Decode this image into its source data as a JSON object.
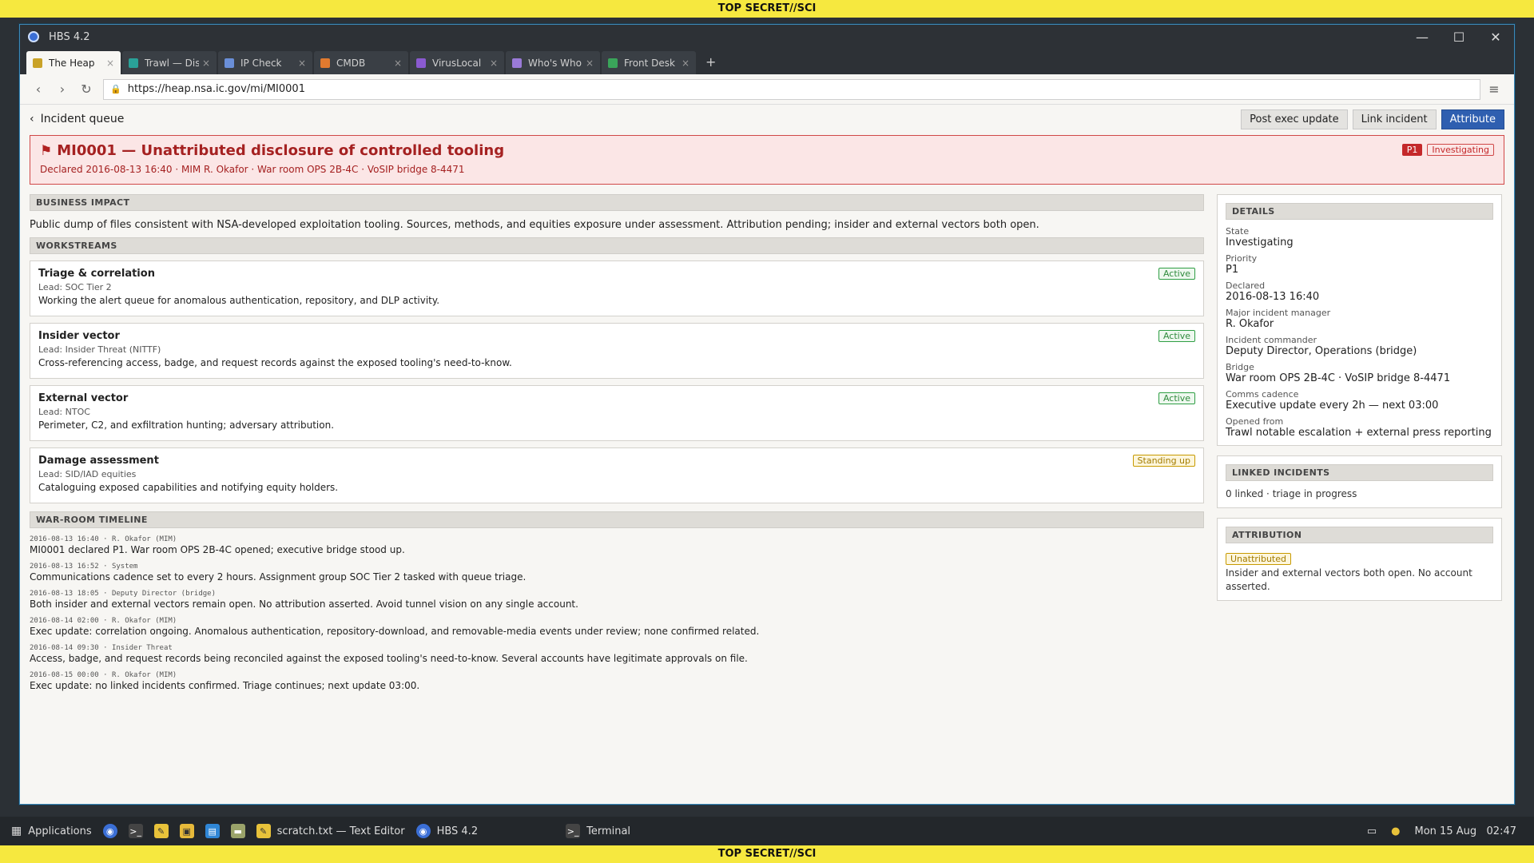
{
  "classification": "TOP SECRET//SCI",
  "window": {
    "title": "HBS 4.2",
    "minimize": "—",
    "maximize": "☐",
    "close": "✕"
  },
  "tabs": [
    {
      "label": "The Heap",
      "icon": "stack-icon",
      "color": "#c9a227"
    },
    {
      "label": "Trawl — Discover",
      "icon": "trawl-icon",
      "color": "#2aa198"
    },
    {
      "label": "IP Check",
      "icon": "globe-icon",
      "color": "#6a8fd8"
    },
    {
      "label": "CMDB",
      "icon": "database-icon",
      "color": "#e07a2f"
    },
    {
      "label": "VirusLocal",
      "icon": "shield-icon",
      "color": "#8a5ad0"
    },
    {
      "label": "Who's Who",
      "icon": "person-icon",
      "color": "#9a7ad8"
    },
    {
      "label": "Front Desk",
      "icon": "bell-icon",
      "color": "#3aa55a"
    }
  ],
  "tab_close": "×",
  "new_tab": "+",
  "nav": {
    "back": "‹",
    "forward": "›",
    "reload": "↻",
    "url": "https://heap.nsa.ic.gov/mi/MI0001",
    "menu": "≡"
  },
  "header": {
    "back_label": "Incident queue",
    "buttons": {
      "post": "Post exec update",
      "link": "Link incident",
      "attribute": "Attribute"
    }
  },
  "incident": {
    "title": "MI0001 — Unattributed disclosure of controlled tooling",
    "meta": "Declared 2016-08-13 16:40  ·  MIM R. Okafor  ·  War room OPS 2B-4C · VoSIP bridge 8-4471",
    "priority": "P1",
    "state": "Investigating"
  },
  "impact": {
    "heading": "BUSINESS IMPACT",
    "text": "Public dump of files consistent with NSA-developed exploitation tooling. Sources, methods, and equities exposure under assessment. Attribution pending; insider and external vectors both open."
  },
  "workstreams": {
    "heading": "WORKSTREAMS",
    "items": [
      {
        "title": "Triage & correlation",
        "lead": "Lead: SOC Tier 2",
        "desc": "Working the alert queue for anomalous authentication, repository, and DLP activity.",
        "status": "Active"
      },
      {
        "title": "Insider vector",
        "lead": "Lead: Insider Threat (NITTF)",
        "desc": "Cross-referencing access, badge, and request records against the exposed tooling's need-to-know.",
        "status": "Active"
      },
      {
        "title": "External vector",
        "lead": "Lead: NTOC",
        "desc": "Perimeter, C2, and exfiltration hunting; adversary attribution.",
        "status": "Active"
      },
      {
        "title": "Damage assessment",
        "lead": "Lead: SID/IAD equities",
        "desc": "Cataloguing exposed capabilities and notifying equity holders.",
        "status": "Standing up"
      }
    ]
  },
  "timeline": {
    "heading": "WAR-ROOM TIMELINE",
    "entries": [
      {
        "meta": "2016-08-13 16:40 · R. Okafor (MIM)",
        "text": "MI0001 declared P1. War room OPS 2B-4C opened; executive bridge stood up."
      },
      {
        "meta": "2016-08-13 16:52 · System",
        "text": "Communications cadence set to every 2 hours. Assignment group SOC Tier 2 tasked with queue triage."
      },
      {
        "meta": "2016-08-13 18:05 · Deputy Director (bridge)",
        "text": "Both insider and external vectors remain open. No attribution asserted. Avoid tunnel vision on any single account."
      },
      {
        "meta": "2016-08-14 02:00 · R. Okafor (MIM)",
        "text": "Exec update: correlation ongoing. Anomalous authentication, repository-download, and removable-media events under review; none confirmed related."
      },
      {
        "meta": "2016-08-14 09:30 · Insider Threat",
        "text": "Access, badge, and request records being reconciled against the exposed tooling's need-to-know. Several accounts have legitimate approvals on file."
      },
      {
        "meta": "2016-08-15 00:00 · R. Okafor (MIM)",
        "text": "Exec update: no linked incidents confirmed. Triage continues; next update 03:00."
      }
    ]
  },
  "details": {
    "heading": "DETAILS",
    "fields": [
      {
        "label": "State",
        "value": "Investigating"
      },
      {
        "label": "Priority",
        "value": "P1"
      },
      {
        "label": "Declared",
        "value": "2016-08-13 16:40"
      },
      {
        "label": "Major incident manager",
        "value": "R. Okafor"
      },
      {
        "label": "Incident commander",
        "value": "Deputy Director, Operations (bridge)"
      },
      {
        "label": "Bridge",
        "value": "War room OPS 2B-4C · VoSIP bridge 8-4471"
      },
      {
        "label": "Comms cadence",
        "value": "Executive update every 2h — next 03:00"
      },
      {
        "label": "Opened from",
        "value": "Trawl notable escalation + external press reporting"
      }
    ]
  },
  "linked": {
    "heading": "LINKED INCIDENTS",
    "text": "0 linked · triage in progress"
  },
  "attribution": {
    "heading": "ATTRIBUTION",
    "badge": "Unattributed",
    "text": "Insider and external vectors both open. No account asserted."
  },
  "taskbar": {
    "apps_label": "Applications",
    "editor_label": "scratch.txt — Text Editor",
    "browser_label": "HBS 4.2",
    "terminal_label": "Terminal",
    "clock_date": "Mon 15 Aug",
    "clock_time": "02:47"
  },
  "colors": {
    "accent": "#2f5fb0",
    "critical": "#c4282a",
    "active": "#2f9e44",
    "warning": "#c79a00",
    "classification": "#f6e83f"
  }
}
